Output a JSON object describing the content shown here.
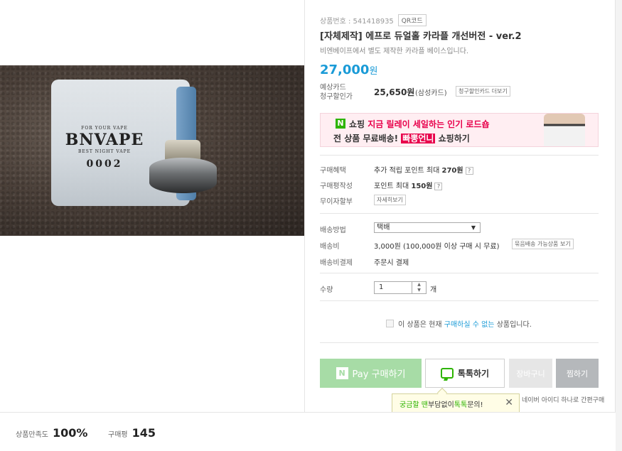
{
  "product": {
    "number_label": "상품번호 : 541418935",
    "qr_label": "QR코드",
    "title": "[자체제작] 에프로 듀얼홀 카라플 개선버전 - ver.2",
    "subtitle": "비엔베이프에서 별도 제작한 카라플 베이스입니다.",
    "price": "27,000",
    "price_unit": "원"
  },
  "photo": {
    "brand_top": "FOR YOUR VAPE",
    "brand": "BNVAPE",
    "brand_bottom": "BEST NIGHT VAPE",
    "number": "0002"
  },
  "card": {
    "label_line1": "예상카드",
    "label_line2": "청구할인가",
    "price": "25,650원",
    "card_name": "(삼성카드)",
    "more_button": "청구할인카드 더보기"
  },
  "banner": {
    "logo": "N",
    "line1_prefix": "쇼핑 ",
    "line1_highlight": "지금 릴레이 세일하는 인기 로드숍",
    "line2_prefix": "전 상품 무료배송! ",
    "line2_highlight": "빠뽕언니",
    "line2_suffix": " 쇼핑하기"
  },
  "benefits": {
    "purchase_label": "구매혜택",
    "purchase_value_prefix": "추가 적립 포인트 최대 ",
    "purchase_value_bold": "270원",
    "review_label": "구매평작성",
    "review_value_prefix": "포인트 최대 ",
    "review_value_bold": "150원",
    "installment_label": "무이자할부",
    "installment_button": "자세히보기",
    "question_mark": "?"
  },
  "shipping": {
    "method_label": "배송방법",
    "method_value": "택배",
    "fee_label": "배송비",
    "fee_value": "3,000원  (100,000원 이상 구매 시 무료)",
    "fee_button": "묶음배송 가능상품 보기",
    "payment_label": "배송비결제",
    "payment_value": "주문시 결제"
  },
  "quantity": {
    "label": "수량",
    "value": "1",
    "unit": "개"
  },
  "notice": {
    "prefix": "이 상품은 현재 ",
    "highlight": "구매하실 수 없는",
    "suffix": " 상품입니다."
  },
  "buttons": {
    "pay_logo": "N",
    "pay": "Pay 구매하기",
    "talk": "톡톡하기",
    "cart": "장바구니",
    "zzim": "찜하기"
  },
  "naver_note": "네이버 아이디 하나로 간편구매",
  "tooltip": {
    "part1": "궁금할 땐",
    "part2": " 부담없이 ",
    "part3": "톡톡",
    "part4": "문의!",
    "close": "✕"
  },
  "footer": {
    "satisfaction_label": "상품만족도",
    "satisfaction_value": "100%",
    "reviews_label": "구매평",
    "reviews_value": "145"
  },
  "colors": {
    "accent_blue": "#1a9bd7",
    "naver_green": "#2db400",
    "banner_pink": "#e8004b"
  }
}
